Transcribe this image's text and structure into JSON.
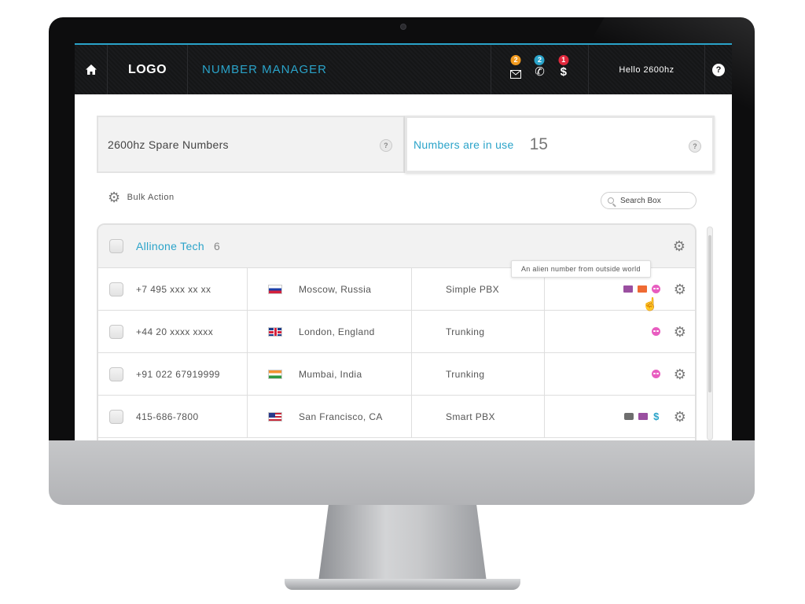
{
  "header": {
    "logo": "LOGO",
    "app_title": "NUMBER MANAGER",
    "notifications": [
      {
        "icon": "voicemail-icon",
        "count": "2",
        "color": "#f29a1e"
      },
      {
        "icon": "phone-icon",
        "count": "2",
        "color": "#2aa3c9"
      },
      {
        "icon": "dollar-icon",
        "count": "1",
        "color": "#e0283c"
      }
    ],
    "greeting": "Hello 2600hz",
    "help": "?"
  },
  "summary": {
    "spare_label": "2600hz Spare Numbers",
    "in_use_label": "Numbers are in use",
    "in_use_count": "15"
  },
  "toolbar": {
    "bulk_action": "Bulk Action",
    "search_placeholder": "Search Box"
  },
  "group": {
    "name": "Allinone Tech",
    "count": "6"
  },
  "rows": [
    {
      "number": "+7 495 xxx xx xx",
      "location": "Moscow, Russia",
      "type": "Simple PBX",
      "flag": "ru",
      "features": [
        "mail-icon",
        "fax-icon",
        "alien-icon"
      ]
    },
    {
      "number": "+44 20 xxxx xxxx",
      "location": "London, England",
      "type": "Trunking",
      "flag": "gb",
      "features": [
        "alien-icon"
      ]
    },
    {
      "number": "+91 022 67919999",
      "location": "Mumbai, India",
      "type": "Trunking",
      "flag": "in",
      "features": [
        "alien-icon"
      ]
    },
    {
      "number": "415-686-7800",
      "location": "San Francisco, CA",
      "type": "Smart PBX",
      "flag": "us",
      "features": [
        "printer-icon",
        "mail-icon",
        "dollar-icon"
      ]
    }
  ],
  "tooltip": "An alien number from outside world",
  "colors": {
    "accent": "#2aa3c9",
    "header_bg": "#151617"
  }
}
